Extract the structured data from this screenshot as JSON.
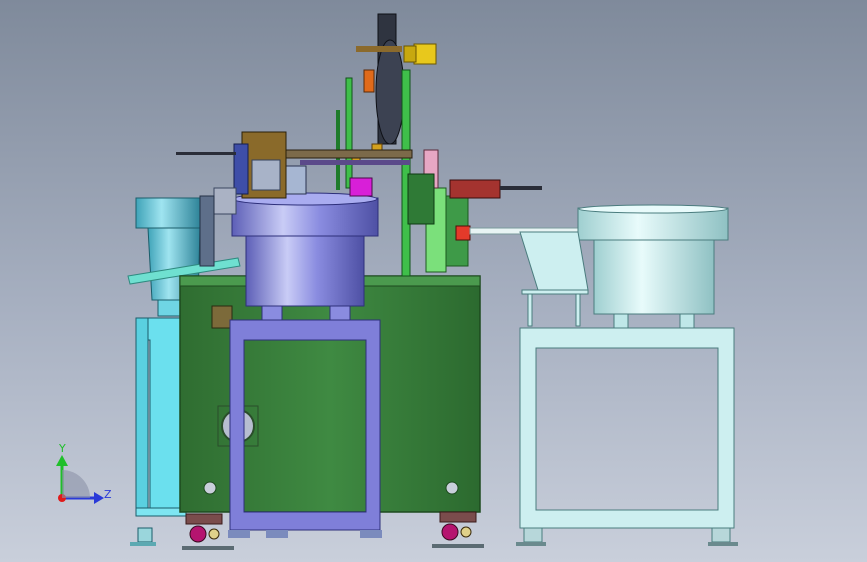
{
  "triad": {
    "y_label": "Y",
    "z_label": "Z"
  },
  "colors": {
    "frame_green": "#3a7d3c",
    "hopper_blue": "#7f7fd9",
    "cyan_frame": "#5ad8e8",
    "mint_frame": "#cdeff0",
    "yellow_motor": "#e8c81c",
    "magenta_part": "#d81fd8"
  }
}
